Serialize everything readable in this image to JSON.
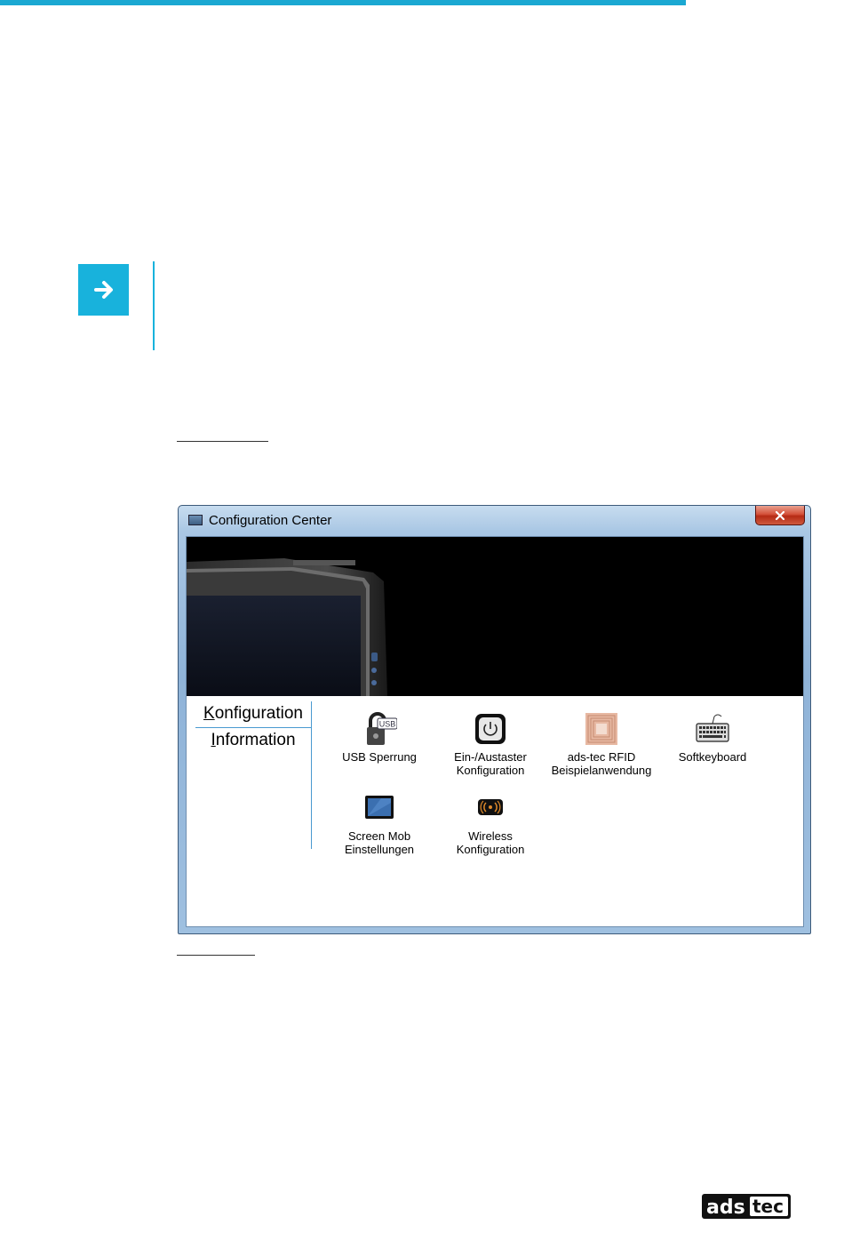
{
  "window": {
    "title": "Configuration Center",
    "close_label": "x"
  },
  "nav": {
    "items": [
      {
        "label_first": "K",
        "label_rest": "onfiguration",
        "active": true
      },
      {
        "label_first": "I",
        "label_rest": "nformation",
        "active": false
      }
    ]
  },
  "tools": [
    {
      "line1": "USB Sperrung",
      "line2": "",
      "icon": "usb-lock-icon"
    },
    {
      "line1": "Ein-/Austaster",
      "line2": "Konfiguration",
      "icon": "power-button-icon"
    },
    {
      "line1": "ads-tec RFID",
      "line2": "Beispielanwendung",
      "icon": "rfid-chip-icon"
    },
    {
      "line1": "Softkeyboard",
      "line2": "",
      "icon": "keyboard-icon"
    },
    {
      "line1": "Screen Mob",
      "line2": "Einstellungen",
      "icon": "screen-icon"
    },
    {
      "line1": "Wireless",
      "line2": "Konfiguration",
      "icon": "wireless-icon"
    }
  ],
  "logo": {
    "text_a": "ads",
    "text_b": "tec"
  },
  "colors": {
    "accent": "#18b2dc"
  }
}
